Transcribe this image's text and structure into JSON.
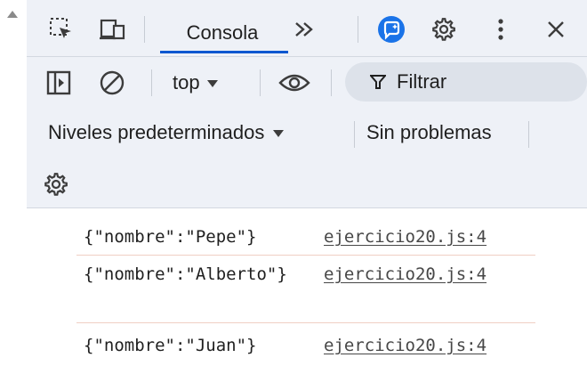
{
  "tabs": {
    "active_label": "Consola"
  },
  "toolbar": {
    "context_value": "top",
    "filter_placeholder": "Filtrar",
    "levels_label": "Niveles predeterminados",
    "issues_label": "Sin problemas"
  },
  "console": {
    "messages": [
      {
        "text": "{\"nombre\":\"Pepe\"}",
        "source": "ejercicio20.js:4"
      },
      {
        "text": "{\"nombre\":\"Alberto\"}",
        "source": "ejercicio20.js:4"
      },
      {
        "text": "{\"nombre\":\"Juan\"}",
        "source": "ejercicio20.js:4"
      }
    ]
  },
  "colors": {
    "toolbar_bg": "#eef1f7",
    "accent": "#0b57d0",
    "divider": "#f0cfc4"
  },
  "icons": [
    "inspect-icon",
    "device-toggle-icon",
    "more-tabs-icon",
    "ai-assistance-icon",
    "settings-icon",
    "kebab-menu-icon",
    "close-icon",
    "sidebar-toggle-icon",
    "clear-console-icon",
    "dropdown-arrow-icon",
    "live-expression-eye-icon",
    "filter-icon",
    "console-settings-icon"
  ]
}
